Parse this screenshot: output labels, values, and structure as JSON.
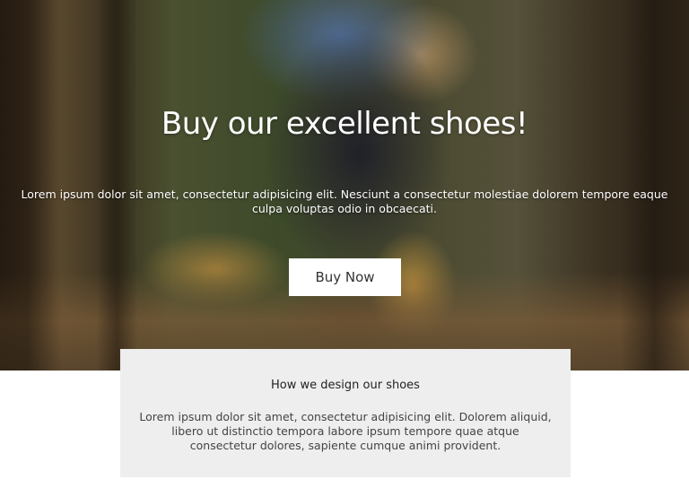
{
  "hero": {
    "background_image": "forest-sitting-person-shoes-photo",
    "title": "Buy our excellent shoes!",
    "text": "Lorem ipsum dolor sit amet, consectetur adipisicing elit. Nesciunt a consectetur molestiae dolorem tempore eaque culpa voluptas odio in obcaecati.",
    "button_label": "Buy Now"
  },
  "design_section": {
    "heading": "How we design our shoes",
    "text": "Lorem ipsum dolor sit amet, consectetur adipisicing elit. Dolorem aliquid, libero ut distinctio tempora labore ipsum tempore quae atque consectetur dolores, sapiente cumque animi provident."
  },
  "colors": {
    "hero_text": "#ffffff",
    "button_bg": "#ffffff",
    "card_bg": "#eeeeee"
  }
}
